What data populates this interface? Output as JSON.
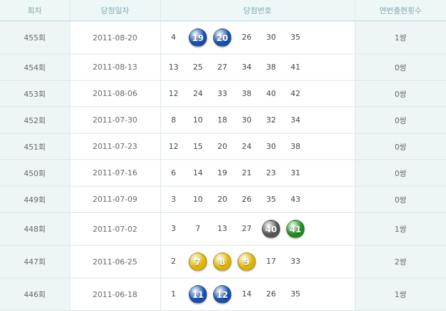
{
  "headers": {
    "round": "회차",
    "date": "당첨일자",
    "numbers": "당첨번호",
    "count": "연번출현횟수"
  },
  "colors": {
    "blue": "#1450b0",
    "green": "#1c8c1c",
    "gray": "#555555",
    "yellow": "#e0b400"
  },
  "rows": [
    {
      "round": "455회",
      "date": "2011-08-20",
      "count": "1쌍",
      "nums": [
        {
          "v": "4"
        },
        {
          "v": "19",
          "ball": "blue"
        },
        {
          "v": "20",
          "ball": "blue"
        },
        {
          "v": "26"
        },
        {
          "v": "30"
        },
        {
          "v": "35"
        }
      ]
    },
    {
      "round": "454회",
      "date": "2011-08-13",
      "count": "0쌍",
      "nums": [
        {
          "v": "13"
        },
        {
          "v": "25"
        },
        {
          "v": "27"
        },
        {
          "v": "34"
        },
        {
          "v": "38"
        },
        {
          "v": "41"
        }
      ]
    },
    {
      "round": "453회",
      "date": "2011-08-06",
      "count": "0쌍",
      "nums": [
        {
          "v": "12"
        },
        {
          "v": "24"
        },
        {
          "v": "33"
        },
        {
          "v": "38"
        },
        {
          "v": "40"
        },
        {
          "v": "42"
        }
      ]
    },
    {
      "round": "452회",
      "date": "2011-07-30",
      "count": "0쌍",
      "nums": [
        {
          "v": "8"
        },
        {
          "v": "10"
        },
        {
          "v": "18"
        },
        {
          "v": "30"
        },
        {
          "v": "32"
        },
        {
          "v": "34"
        }
      ]
    },
    {
      "round": "451회",
      "date": "2011-07-23",
      "count": "0쌍",
      "nums": [
        {
          "v": "12"
        },
        {
          "v": "15"
        },
        {
          "v": "20"
        },
        {
          "v": "24"
        },
        {
          "v": "30"
        },
        {
          "v": "38"
        }
      ]
    },
    {
      "round": "450회",
      "date": "2011-07-16",
      "count": "0쌍",
      "nums": [
        {
          "v": "6"
        },
        {
          "v": "14"
        },
        {
          "v": "19"
        },
        {
          "v": "21"
        },
        {
          "v": "23"
        },
        {
          "v": "31"
        }
      ]
    },
    {
      "round": "449회",
      "date": "2011-07-09",
      "count": "0쌍",
      "nums": [
        {
          "v": "3"
        },
        {
          "v": "10"
        },
        {
          "v": "20"
        },
        {
          "v": "26"
        },
        {
          "v": "35"
        },
        {
          "v": "43"
        }
      ]
    },
    {
      "round": "448회",
      "date": "2011-07-02",
      "count": "1쌍",
      "nums": [
        {
          "v": "3"
        },
        {
          "v": "7"
        },
        {
          "v": "13"
        },
        {
          "v": "27"
        },
        {
          "v": "40",
          "ball": "gray"
        },
        {
          "v": "41",
          "ball": "green"
        }
      ]
    },
    {
      "round": "447회",
      "date": "2011-06-25",
      "count": "2쌍",
      "nums": [
        {
          "v": "2"
        },
        {
          "v": "7",
          "ball": "yellow"
        },
        {
          "v": "8",
          "ball": "yellow"
        },
        {
          "v": "9",
          "ball": "yellow"
        },
        {
          "v": "17"
        },
        {
          "v": "33"
        }
      ]
    },
    {
      "round": "446회",
      "date": "2011-06-18",
      "count": "1쌍",
      "nums": [
        {
          "v": "1"
        },
        {
          "v": "11",
          "ball": "blue"
        },
        {
          "v": "12",
          "ball": "blue"
        },
        {
          "v": "14"
        },
        {
          "v": "26"
        },
        {
          "v": "35"
        }
      ]
    }
  ]
}
